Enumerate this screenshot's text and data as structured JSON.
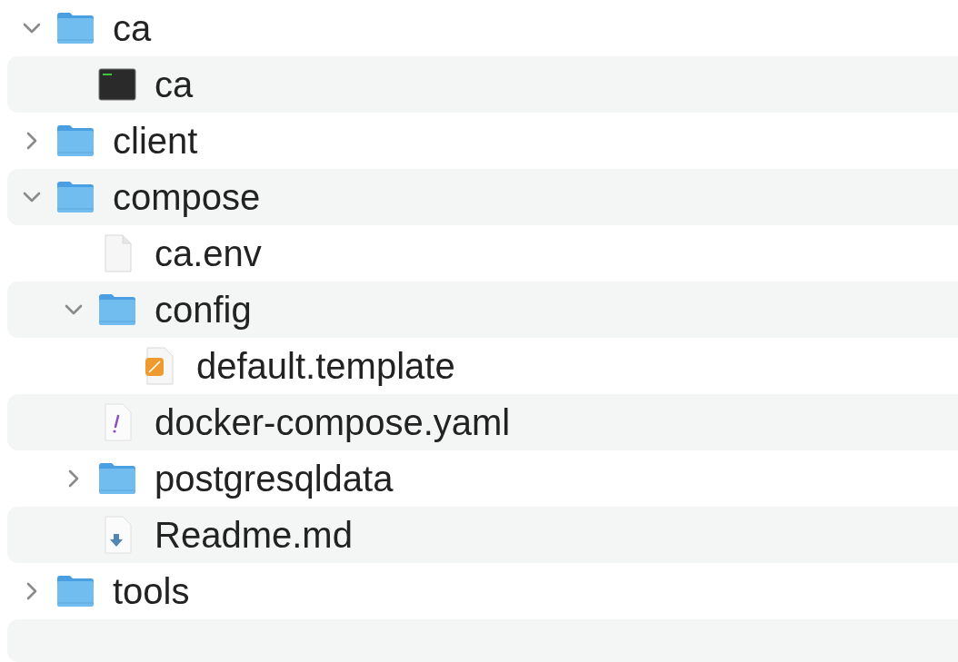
{
  "tree": [
    {
      "name": "ca",
      "kind": "folder",
      "expanded": true,
      "children": [
        {
          "name": "ca",
          "kind": "executable"
        }
      ]
    },
    {
      "name": "client",
      "kind": "folder",
      "expanded": false
    },
    {
      "name": "compose",
      "kind": "folder",
      "expanded": true,
      "children": [
        {
          "name": "ca.env",
          "kind": "document"
        },
        {
          "name": "config",
          "kind": "folder",
          "expanded": true,
          "children": [
            {
              "name": "default.template",
              "kind": "template"
            }
          ]
        },
        {
          "name": "docker-compose.yaml",
          "kind": "yaml"
        },
        {
          "name": "postgresqldata",
          "kind": "folder",
          "expanded": false
        },
        {
          "name": "Readme.md",
          "kind": "markdown"
        }
      ]
    },
    {
      "name": "tools",
      "kind": "folder",
      "expanded": false
    }
  ]
}
